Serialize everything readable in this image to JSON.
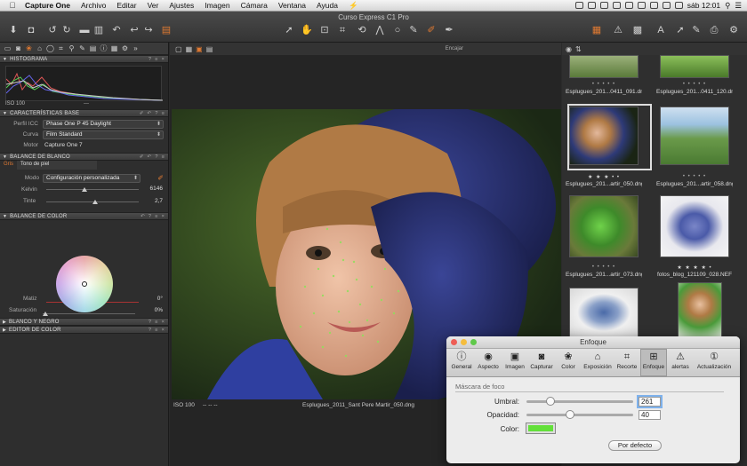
{
  "menubar": {
    "app": "Capture One",
    "items": [
      "Archivo",
      "Editar",
      "Ver",
      "Ajustes",
      "Imagen",
      "Cámara",
      "Ventana",
      "Ayuda"
    ],
    "clock": "sáb 12:01"
  },
  "window": {
    "title": "Curso Express C1 Pro"
  },
  "left": {
    "histogram": {
      "header": "HISTOGRAMA",
      "iso": "ISO 100",
      "dash": "---"
    },
    "base": {
      "header": "CARACTERÍSTICAS BASE",
      "icc_label": "Perfil ICC",
      "icc_value": "Phase One P 45 Daylight",
      "curve_label": "Curva",
      "curve_value": "Film Standard",
      "motor_label": "Motor",
      "motor_value": "Capture One 7"
    },
    "wb": {
      "header": "BALANCE DE BLANCO",
      "tab1": "Gris",
      "tab2": "Tono de piel",
      "mode_label": "Modo",
      "mode_value": "Configuración personalizada",
      "kelvin_label": "Kelvin",
      "kelvin_value": "6146",
      "tint_label": "Tinte",
      "tint_value": "2,7"
    },
    "color": {
      "header": "BALANCE DE COLOR",
      "hue_label": "Matiz",
      "hue_value": "0°",
      "sat_label": "Saturación",
      "sat_value": "0%"
    },
    "bw": {
      "header": "BLANCO Y NEGRO"
    },
    "editor": {
      "header": "EDITOR DE COLOR"
    }
  },
  "viewer": {
    "encajar": "Encajar",
    "iso": "ISO 100",
    "dashes": "--   --    --",
    "filename": "Esplugues_2011_Sant Pere Martir_050.dng"
  },
  "browser": {
    "thumbs": [
      {
        "name": "Esplugues_201...0411_091.dng",
        "stars": "• • • • •"
      },
      {
        "name": "Esplugues_201...0411_120.dng",
        "stars": "• • • • •"
      },
      {
        "name": "Esplugues_201...artir_050.dng",
        "stars": "★ ★ ★ • •"
      },
      {
        "name": "Esplugues_201...artir_058.dng",
        "stars": "• • • • •"
      },
      {
        "name": "Esplugues_201...artir_073.dng",
        "stars": "• • • • •"
      },
      {
        "name": "fotos_blog_121109_028.NEF",
        "stars": "★ ★ ★ ★ •"
      }
    ]
  },
  "dialog": {
    "title": "Enfoque",
    "tabs": [
      {
        "label": "General",
        "glyph": "ⓘ"
      },
      {
        "label": "Aspecto",
        "glyph": "◉"
      },
      {
        "label": "Imagen",
        "glyph": "▣"
      },
      {
        "label": "Capturar",
        "glyph": "◙"
      },
      {
        "label": "Color",
        "glyph": "❀"
      },
      {
        "label": "Exposición",
        "glyph": "⌂"
      },
      {
        "label": "Recorte",
        "glyph": "⌗"
      },
      {
        "label": "Enfoque",
        "glyph": "⊞"
      },
      {
        "label": "alertas",
        "glyph": "⚠"
      },
      {
        "label": "Actualización",
        "glyph": "①"
      }
    ],
    "section": "Máscara de foco",
    "umbral_label": "Umbral:",
    "umbral_value": "261",
    "opacidad_label": "Opacidad:",
    "opacidad_value": "40",
    "color_label": "Color:",
    "swatch_color": "#63e03a",
    "default_button": "Por defecto"
  }
}
